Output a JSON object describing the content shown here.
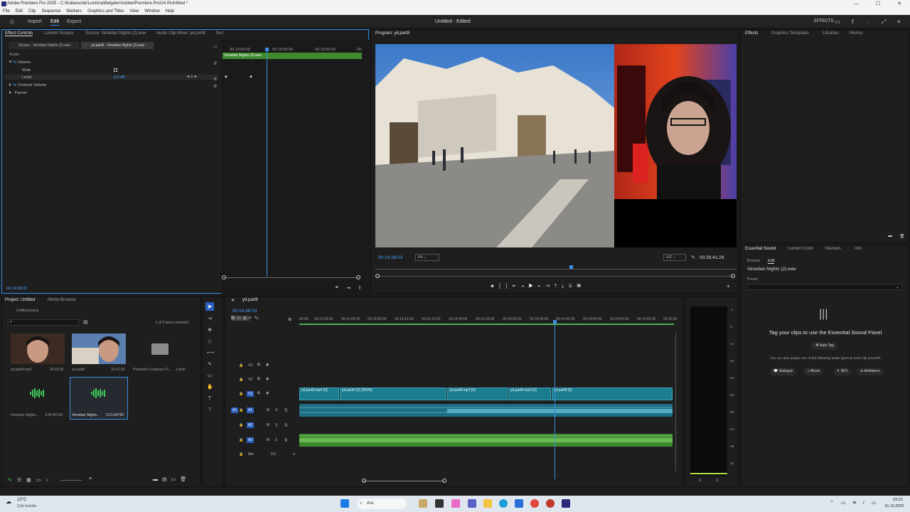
{
  "titlebar": {
    "title": "Adobe Premiere Pro 2025 - C:\\Kullanıcılar\\Lumirca\\Belgeler\\Adobe\\Premiere Pro\\24.0\\Untitled *",
    "minimize": "—",
    "maximize": "☐",
    "close": "✕"
  },
  "menubar": {
    "items": [
      "File",
      "Edit",
      "Clip",
      "Sequence",
      "Markers",
      "Graphics and Titles",
      "View",
      "Window",
      "Help"
    ]
  },
  "header": {
    "tabs": [
      "Import",
      "Edit",
      "Export"
    ],
    "doc_title": "Untitled - Edited",
    "effects_label": "EFFECTS"
  },
  "effect_controls": {
    "tabs": [
      "Effect Controls",
      "Lumetri Scopes",
      "Source: Venetian Nights (2).wav",
      "Audio Clip Mixer: yd.part8",
      "Text"
    ],
    "source_chip": "Source - Venetian Nights (2).wav",
    "seq_chip": "yd.part8 - Venetian Nights (2).wav",
    "section": "Audio",
    "rows": [
      "Volume",
      "Mute",
      "Level",
      "Channel Volume",
      "Panner"
    ],
    "level_value": "0.0 dB",
    "time_ticks": [
      "00:14:00:00",
      "00:15:00:00",
      "00:16:00:00",
      "00:"
    ],
    "clip_name": "Venetian Nights (2).wav",
    "timecode": "00:14:38:03"
  },
  "program": {
    "tab": "Program: yd.part8",
    "timecode": "00:14:38:03",
    "fit": "Fit",
    "resolution": "1/2",
    "duration": "00:26:41:29"
  },
  "right_top": {
    "tabs": [
      "Effects",
      "Graphics Templates",
      "Libraries",
      "History"
    ]
  },
  "essential_sound": {
    "tabs": [
      "Essential Sound",
      "Lumetri Color",
      "Markers",
      "Info"
    ],
    "subtabs": [
      "Browse",
      "Edit"
    ],
    "clip": "Venetian Nights (2).wav",
    "preset_label": "Preset:",
    "headline": "Tag your clips to use the Essential Sound Panel",
    "auto_tag": "Auto Tag",
    "assign_text": "You can also assign one of the following audio types to each clip yourself:",
    "types": [
      "Dialogue",
      "Music",
      "SFX",
      "Ambience"
    ]
  },
  "project": {
    "tabs": [
      "Project: Untitled",
      "Media Browser"
    ],
    "file": "Untitled.prproj",
    "selection": "1 of 5 items selected",
    "items": [
      {
        "name": "yd.part8.mp4",
        "duration": "30:43:25"
      },
      {
        "name": "yd.part8",
        "duration": "26:41:29"
      },
      {
        "name": "Premiere Composer Fi...",
        "duration": "1 item"
      },
      {
        "name": "Venetian Nights...",
        "duration": "3:46:42239"
      },
      {
        "name": "Venetian Nights...",
        "duration": "3:21:05760"
      }
    ]
  },
  "timeline": {
    "tab": "yd.part8",
    "timecode": "00:14:38:03",
    "ruler": [
      "00:00",
      "00:13:55:00",
      "00:14:00:00",
      "00:14:05:00",
      "00:14:10:00",
      "00:14:15:00",
      "00:14:20:00",
      "00:14:25:00",
      "00:14:30:00",
      "00:14:35:00",
      "00:14:40:00",
      "00:14:45:00",
      "00:14:50:00",
      "00:14:55:00",
      "00:15:00"
    ],
    "tracks": [
      "V3",
      "V2",
      "V1",
      "A1",
      "A2",
      "A3",
      "Mix"
    ],
    "mix_value": "0.0",
    "clips": [
      "yd.part8.mp4 [V]",
      "yd.part8 [V] [300%]",
      "yd.part8.mp4 [V]",
      "yd.part8.mp4 [V]",
      "yd.part8 [V]"
    ]
  },
  "meters": {
    "scale": [
      "0",
      "-6",
      "-12",
      "-18",
      "-24",
      "-30",
      "-36",
      "-42",
      "-48",
      "-54"
    ],
    "footer": [
      "S",
      "S"
    ]
  },
  "taskbar": {
    "weather_temp": "13°C",
    "weather_desc": "Çok bulutlu",
    "search": "Ara",
    "time": "03:22",
    "date": "16.10.2025"
  }
}
